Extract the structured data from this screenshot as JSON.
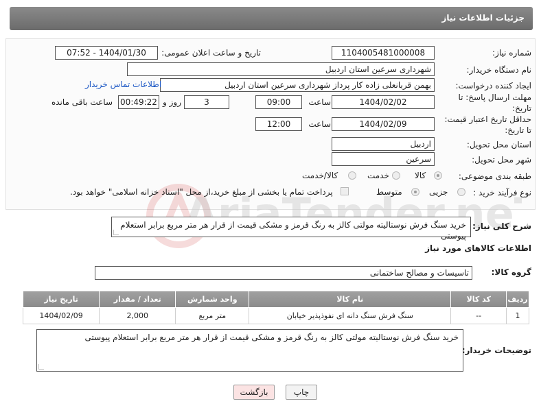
{
  "header": {
    "title": "جزئیات اطلاعات نیاز"
  },
  "fields": {
    "need_number": {
      "label": "شماره نیاز:",
      "value": "1104005481000008"
    },
    "announce_datetime": {
      "label": "تاریخ و ساعت اعلان عمومی:",
      "value": "1404/01/30 - 07:52"
    },
    "buyer_org": {
      "label": "نام دستگاه خریدار:",
      "value": "شهرداری سرعین استان اردبیل"
    },
    "requester": {
      "label": "ایجاد کننده درخواست:",
      "value": "بهمن قربانعلی زاده کار پرداز شهرداری سرعین استان اردبیل",
      "contact_link": "اطلاعات تماس خریدار"
    },
    "reply_deadline": {
      "label_line1": "مهلت ارسال پاسخ: تا",
      "label_line2": "تاریخ:",
      "date": "1404/02/02",
      "time_label": "ساعت",
      "time": "09:00",
      "days": "3",
      "days_label": "روز و",
      "remaining": "00:49:22",
      "remaining_label": "ساعت باقی مانده"
    },
    "price_validity": {
      "label_line1": "حداقل تاریخ اعتبار قیمت:",
      "label_line2": "تا تاریخ:",
      "date": "1404/02/09",
      "time_label": "ساعت",
      "time": "12:00"
    },
    "delivery_province": {
      "label": "استان محل تحویل:",
      "value": "اردبیل"
    },
    "delivery_city": {
      "label": "شهر محل تحویل:",
      "value": "سرعین"
    },
    "category": {
      "label": "طبقه بندی موضوعی:",
      "options": [
        "کالا",
        "خدمت",
        "کالا/خدمت"
      ],
      "selected": "کالا"
    },
    "purchase_type": {
      "label": "نوع فرآیند خرید :",
      "options": [
        "جزیی",
        "متوسط"
      ],
      "selected": "متوسط",
      "payment_note": "پرداخت تمام یا بخشی از مبلغ خرید،از محل \"اسناد خزانه اسلامی\" خواهد بود."
    }
  },
  "general_description": {
    "label": "شرح کلی نیاز:",
    "value": "خرید سنگ فرش نوستالیته مولتی کالز به رنگ قرمز و مشکی قیمت از قرار هر متر مربع برابر استعلام پیوستی"
  },
  "goods_section": {
    "title": "اطلاعات کالاهای مورد نیاز",
    "group_label": "گروه کالا:",
    "group_value": "تاسیسات و مصالح ساختمانی"
  },
  "table": {
    "headers": [
      "ردیف",
      "کد کالا",
      "نام کالا",
      "واحد شمارش",
      "تعداد / مقدار",
      "تاریخ نیاز"
    ],
    "rows": [
      [
        "1",
        "--",
        "سنگ فرش سنگ دانه ای نفوذپذیر خیابان",
        "متر مربع",
        "2,000",
        "1404/02/09"
      ]
    ]
  },
  "buyer_notes": {
    "label": "توضیحات خریدار:",
    "value": "خرید سنگ فرش نوستالیته مولتی کالز به رنگ قرمز و مشکی قیمت از قرار هر متر مربع برابر استعلام پیوستی"
  },
  "buttons": {
    "print": "چاپ",
    "back": "بازگشت"
  },
  "watermark": {
    "text": "AriaTender.neT"
  }
}
